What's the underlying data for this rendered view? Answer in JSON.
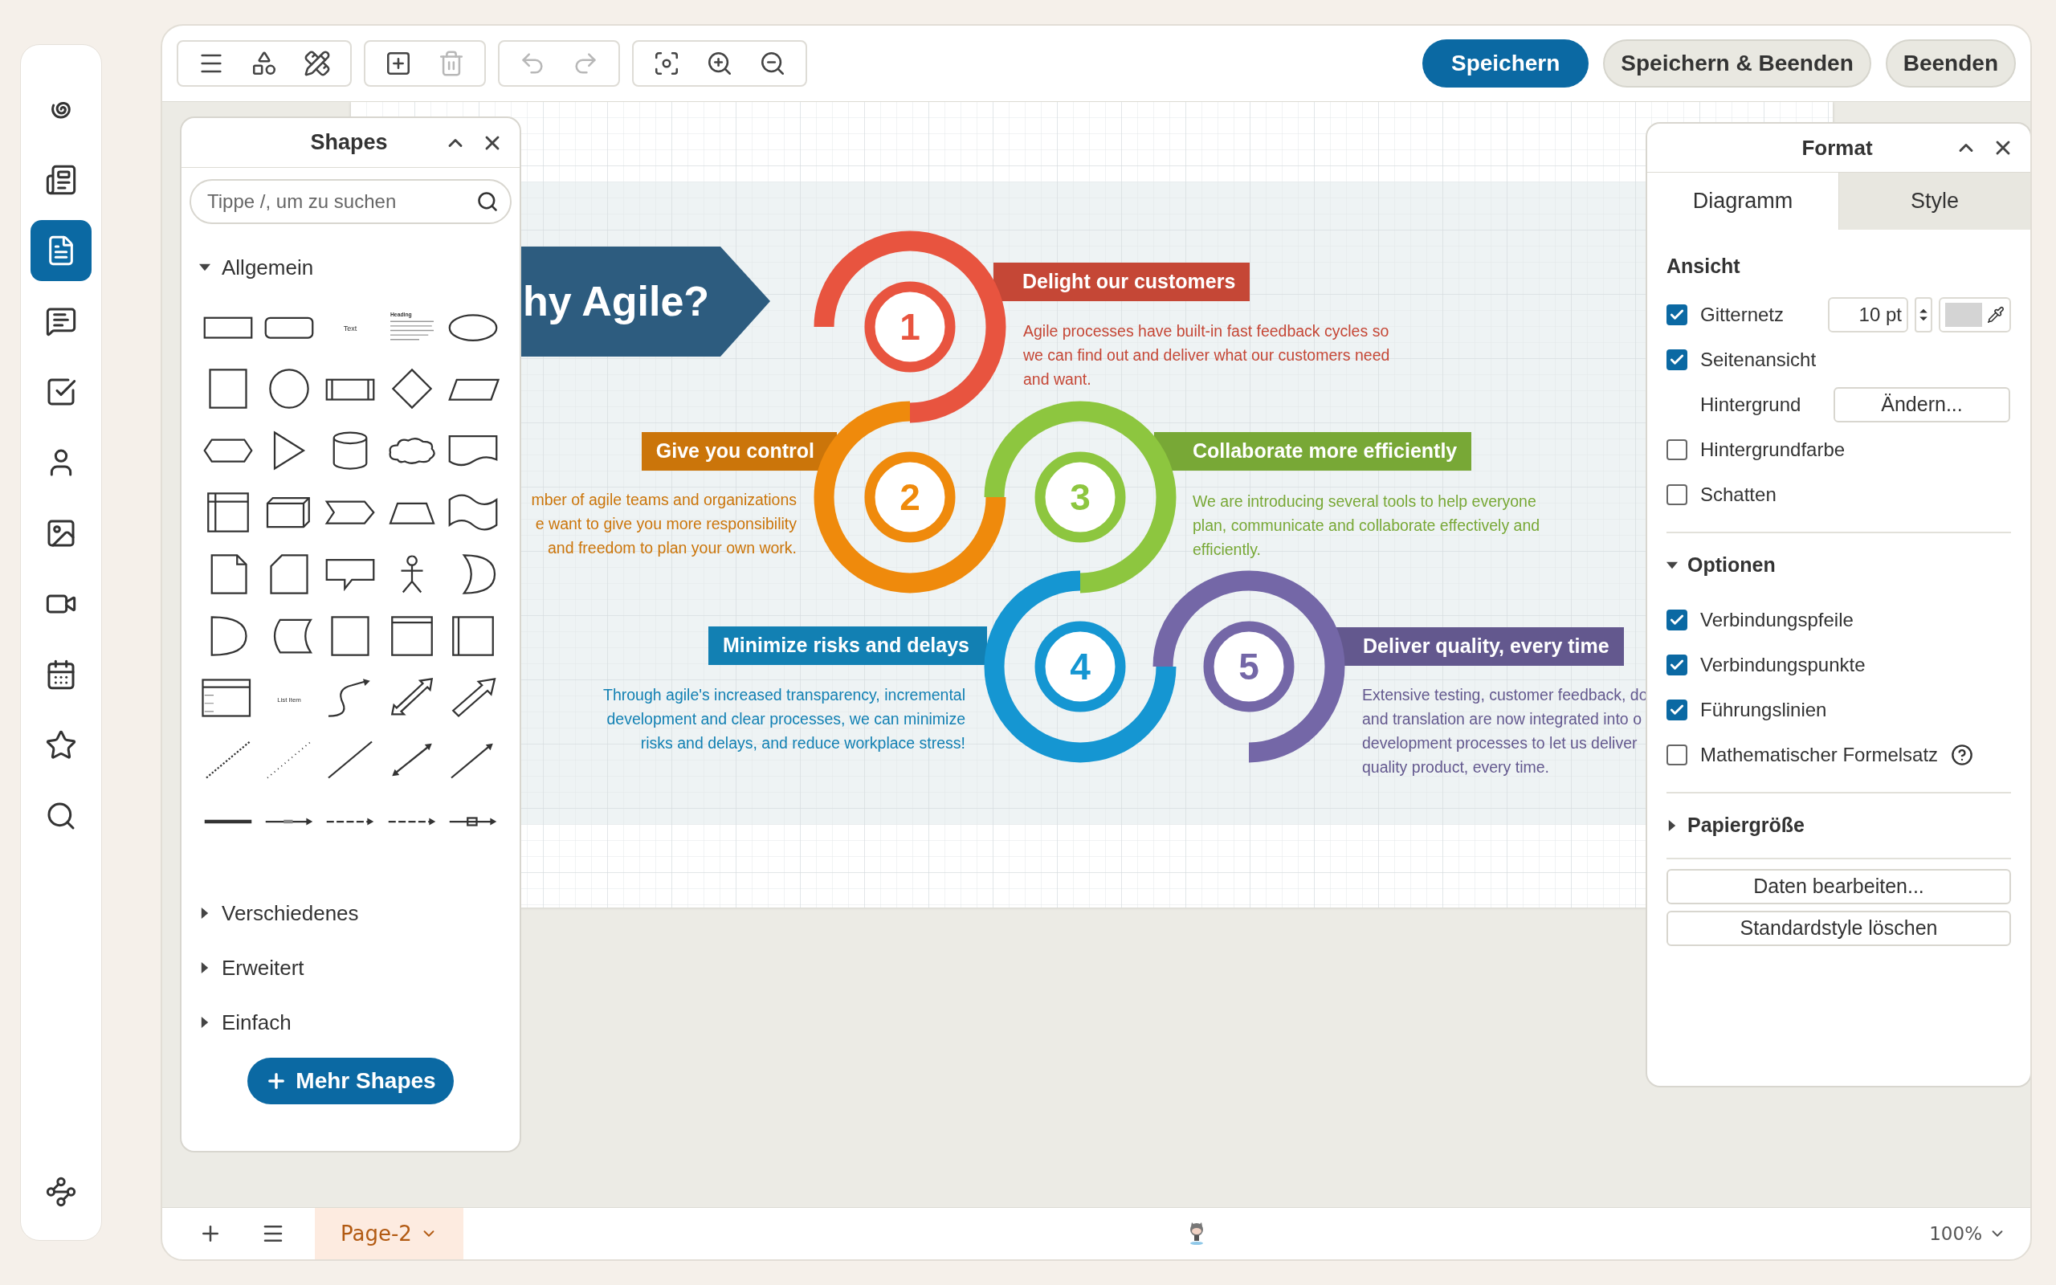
{
  "sidebar": {
    "items": [
      {
        "selected": false
      },
      {
        "selected": false
      },
      {
        "selected": true
      },
      {
        "selected": false
      },
      {
        "selected": false
      },
      {
        "selected": false
      },
      {
        "selected": false
      },
      {
        "selected": false
      },
      {
        "selected": false
      },
      {
        "selected": false
      },
      {
        "selected": false
      },
      {
        "selected": false
      }
    ]
  },
  "toolbar": {
    "tools": [
      {
        "disabled": false
      },
      {
        "disabled": false
      },
      {
        "disabled": false
      },
      {
        "disabled": false
      },
      {
        "disabled": true
      },
      {
        "disabled": true
      },
      {
        "disabled": true
      },
      {
        "disabled": false
      },
      {
        "disabled": false
      },
      {
        "disabled": false
      }
    ],
    "buttons": [
      {
        "label": "Speichern",
        "kind": "primary"
      },
      {
        "label": "Speichern & Beenden",
        "kind": "secondary"
      },
      {
        "label": "Beenden",
        "kind": "secondary"
      }
    ]
  },
  "diagram": {
    "banner": "hy Agile?",
    "steps": [
      {
        "number": "1",
        "title": "Delight our customers",
        "color": "#e8543f",
        "lines": [
          "Agile processes have built-in fast feedback cycles so",
          "we can find out and deliver what our customers need",
          "and want."
        ]
      },
      {
        "number": "2",
        "title": "Give you control",
        "color": "#ef8a0c",
        "lines": [
          "mber of agile teams and organizations",
          "e want to give you more responsibility",
          "and freedom to plan your own work."
        ]
      },
      {
        "number": "3",
        "title": "Collaborate more efficiently",
        "color": "#8dc63f",
        "lines": [
          "We are introducing several tools to help everyone",
          "plan, communicate and collaborate effectively and",
          "efficiently."
        ]
      },
      {
        "number": "4",
        "title": "Minimize risks and delays",
        "color": "#1596d2",
        "lines": [
          "Through agile's increased transparency, incremental",
          "development and clear processes, we can minimize",
          "risks and delays, and reduce workplace stress!"
        ]
      },
      {
        "number": "5",
        "title": "Deliver quality, every time",
        "color": "#7467a7",
        "lines": [
          "Extensive testing, customer feedback, do",
          "and translation are now integrated into o",
          "development processes to let us deliver",
          "quality product, every time."
        ]
      }
    ]
  },
  "shapes_panel": {
    "title": "Shapes",
    "search": {
      "placeholder": "Tippe /, um zu suchen"
    },
    "sections": [
      {
        "label": "Allgemein",
        "expanded": true,
        "shapes": [
          {
            "kind": "rect"
          },
          {
            "kind": "rounded"
          },
          {
            "kind": "text",
            "label": "Text"
          },
          {
            "kind": "heading",
            "label": "Heading"
          },
          {
            "kind": "ellipse"
          },
          {
            "kind": "square"
          },
          {
            "kind": "circle"
          },
          {
            "kind": "process"
          },
          {
            "kind": "diamond"
          },
          {
            "kind": "parallelogram"
          },
          {
            "kind": "hexagon"
          },
          {
            "kind": "triangle"
          },
          {
            "kind": "cylinder"
          },
          {
            "kind": "cloud"
          },
          {
            "kind": "document"
          },
          {
            "kind": "storage"
          },
          {
            "kind": "cube"
          },
          {
            "kind": "step"
          },
          {
            "kind": "trapezoid"
          },
          {
            "kind": "tape"
          },
          {
            "kind": "note"
          },
          {
            "kind": "card"
          },
          {
            "kind": "callout"
          },
          {
            "kind": "actor"
          },
          {
            "kind": "crescent"
          },
          {
            "kind": "delay"
          },
          {
            "kind": "datastore"
          },
          {
            "kind": "square"
          },
          {
            "kind": "frame"
          },
          {
            "kind": "swimlane"
          },
          {
            "kind": "list"
          },
          {
            "kind": "text",
            "label": "List Item"
          },
          {
            "kind": "curve"
          },
          {
            "kind": "twoway"
          },
          {
            "kind": "blockarrow"
          },
          {
            "kind": "dotted"
          },
          {
            "kind": "dashed"
          },
          {
            "kind": "line"
          },
          {
            "kind": "doublearrow"
          },
          {
            "kind": "arrow"
          },
          {
            "kind": "thick"
          },
          {
            "kind": "labeled"
          },
          {
            "kind": "sourced"
          },
          {
            "kind": "sourced"
          },
          {
            "kind": "boxed"
          }
        ]
      },
      {
        "label": "Verschiedenes",
        "expanded": false
      },
      {
        "label": "Erweitert",
        "expanded": false
      },
      {
        "label": "Einfach",
        "expanded": false
      }
    ],
    "more_button": "Mehr Shapes"
  },
  "format_panel": {
    "title": "Format",
    "tabs": [
      {
        "label": "Diagramm",
        "selected": true
      },
      {
        "label": "Style",
        "selected": false
      }
    ],
    "sections": [
      {
        "title": "Ansicht",
        "kind": "plain",
        "rows": [
          {
            "kind": "check",
            "label": "Gitternetz",
            "checked": true,
            "value": "10 pt"
          },
          {
            "kind": "check",
            "label": "Seitenansicht",
            "checked": true
          },
          {
            "kind": "button",
            "label": "Hintergrund",
            "button": "Ändern..."
          },
          {
            "kind": "check",
            "label": "Hintergrundfarbe",
            "checked": false
          },
          {
            "kind": "check",
            "label": "Schatten",
            "checked": false
          }
        ]
      },
      {
        "title": "Optionen",
        "kind": "collapsible",
        "expanded": true,
        "rows": [
          {
            "kind": "check",
            "label": "Verbindungspfeile",
            "checked": true
          },
          {
            "kind": "check",
            "label": "Verbindungspunkte",
            "checked": true
          },
          {
            "kind": "check",
            "label": "Führungslinien",
            "checked": true
          },
          {
            "kind": "check",
            "label": "Mathematischer Formelsatz",
            "checked": false,
            "help": true
          }
        ]
      },
      {
        "title": "Papiergröße",
        "kind": "collapsible",
        "expanded": false
      }
    ],
    "buttons": [
      "Daten bearbeiten...",
      "Standardstyle löschen"
    ]
  },
  "status_bar": {
    "pages": [
      {
        "label": "Page-2",
        "selected": true
      }
    ],
    "zoom": "100%"
  }
}
